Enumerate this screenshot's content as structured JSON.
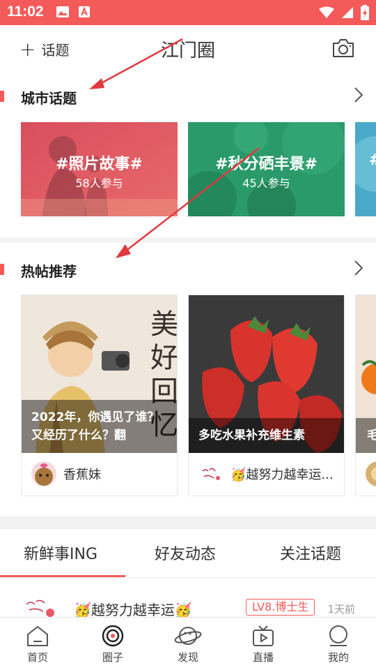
{
  "status_bar": {
    "time": "11:02"
  },
  "header": {
    "add_topic_label": "话题",
    "title": "江门圈"
  },
  "city_topics": {
    "title": "城市话题",
    "cards": [
      {
        "title": "#照片故事#",
        "subtitle": "58人参与"
      },
      {
        "title": "#秋分硒丰景#",
        "subtitle": "45人参与"
      },
      {
        "title": "#"
      }
    ]
  },
  "hot_posts": {
    "title": "热帖推荐",
    "cards": [
      {
        "caption": "2022年，你遇见了谁？又经历了什么？翻",
        "image_text": "美好回忆",
        "user": "香蕉妹"
      },
      {
        "caption": "多吃水果补充维生素",
        "user": "🥳越努力越幸运..."
      },
      {
        "caption": "毛"
      }
    ]
  },
  "tabs": {
    "items": [
      {
        "label": "新鲜事ING"
      },
      {
        "label": "好友动态"
      },
      {
        "label": "关注话题"
      }
    ]
  },
  "feed": {
    "user": "🥳越努力越幸运🥳",
    "badge": "LV8.博士生",
    "time": "1天前"
  },
  "bottom_nav": {
    "items": [
      {
        "label": "首页"
      },
      {
        "label": "圈子"
      },
      {
        "label": "发现"
      },
      {
        "label": "直播"
      },
      {
        "label": "我的"
      }
    ]
  },
  "colors": {
    "accent": "#f55a5a",
    "divider": "#f2f2f2"
  }
}
